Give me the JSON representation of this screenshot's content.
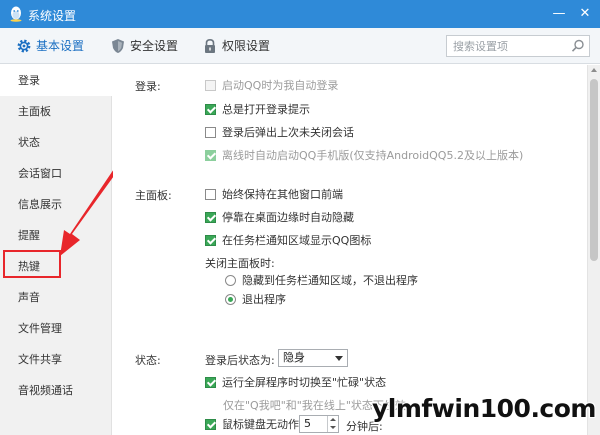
{
  "window": {
    "title": "系统设置",
    "minimize": "—",
    "close": "✕"
  },
  "tabs": [
    {
      "label": "基本设置",
      "icon": "gear-icon",
      "active": true
    },
    {
      "label": "安全设置",
      "icon": "shield-icon",
      "active": false
    },
    {
      "label": "权限设置",
      "icon": "lock-icon",
      "active": false
    }
  ],
  "search": {
    "placeholder": "搜索设置项",
    "value": ""
  },
  "sidebar": {
    "items": [
      {
        "label": "登录",
        "active": true
      },
      {
        "label": "主面板"
      },
      {
        "label": "状态"
      },
      {
        "label": "会话窗口"
      },
      {
        "label": "信息展示"
      },
      {
        "label": "提醒"
      },
      {
        "label": "热键",
        "highlighted": true
      },
      {
        "label": "声音"
      },
      {
        "label": "文件管理"
      },
      {
        "label": "文件共享"
      },
      {
        "label": "音视频通话"
      }
    ]
  },
  "login": {
    "label": "登录:",
    "options": [
      {
        "label": "启动QQ时为我自动登录",
        "checked": false,
        "disabled": true
      },
      {
        "label": "总是打开登录提示",
        "checked": true,
        "disabled": false
      },
      {
        "label": "登录后弹出上次未关闭会话",
        "checked": false,
        "disabled": false
      },
      {
        "label": "离线时自动启动QQ手机版(仅支持AndroidQQ5.2及以上版本)",
        "checked": true,
        "disabled": true
      }
    ]
  },
  "main_panel": {
    "label": "主面板:",
    "options": [
      {
        "label": "始终保持在其他窗口前端",
        "checked": false
      },
      {
        "label": "停靠在桌面边缘时自动隐藏",
        "checked": true
      },
      {
        "label": "在任务栏通知区域显示QQ图标",
        "checked": true
      }
    ],
    "close_label": "关闭主面板时:",
    "close_options": [
      {
        "label": "隐藏到任务栏通知区域，不退出程序",
        "checked": false
      },
      {
        "label": "退出程序",
        "checked": true
      }
    ]
  },
  "status": {
    "label": "状态:",
    "after_login_label": "登录后状态为:",
    "after_login_value": "隐身",
    "fullscreen_option": {
      "label": "运行全屏程序时切换至\"忙碌\"状态",
      "checked": true
    },
    "fullscreen_hint": "仅在\"Q我吧\"和\"我在线上\"状态下生效。",
    "idle_option": {
      "label": "鼠标键盘无动作",
      "checked": true
    },
    "idle_value": "5",
    "idle_unit": "分钟后:"
  },
  "watermark": "ylmfwin100.com",
  "colors": {
    "titlebar": "#2f8ad8",
    "accent": "#1b6fc2",
    "check": "#3aa757",
    "highlight": "#e8262b"
  }
}
